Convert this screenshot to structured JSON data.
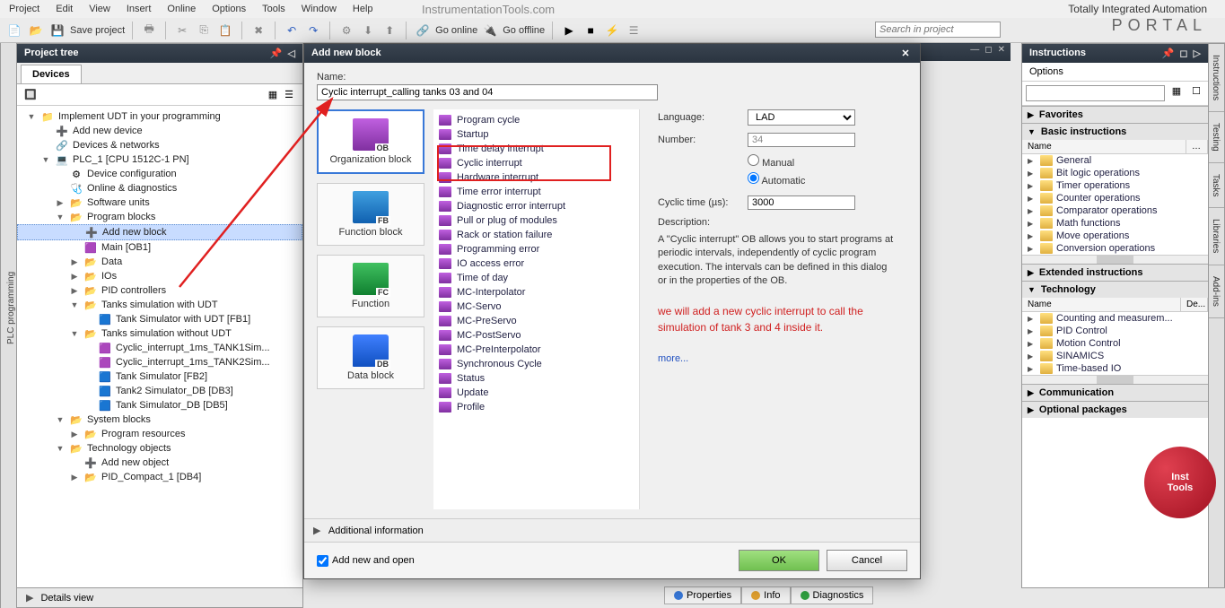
{
  "menus": [
    "Project",
    "Edit",
    "View",
    "Insert",
    "Online",
    "Options",
    "Tools",
    "Window",
    "Help"
  ],
  "watermark": "InstrumentationTools.com",
  "portal_top": "Totally Integrated Automation",
  "portal_big": "PORTAL",
  "toolbar": {
    "save": "Save project",
    "go_online": "Go online",
    "go_offline": "Go offline",
    "search_placeholder": "Search in project"
  },
  "left_tab": "PLC programming",
  "project_tree": {
    "title": "Project tree",
    "tab": "Devices",
    "nodes": [
      {
        "indent": 0,
        "toggle": "▼",
        "icon": "📁",
        "label": "Implement UDT in your programming"
      },
      {
        "indent": 1,
        "toggle": "",
        "icon": "➕",
        "label": "Add new device"
      },
      {
        "indent": 1,
        "toggle": "",
        "icon": "🔗",
        "label": "Devices & networks"
      },
      {
        "indent": 1,
        "toggle": "▼",
        "icon": "💻",
        "label": "PLC_1 [CPU 1512C-1 PN]"
      },
      {
        "indent": 2,
        "toggle": "",
        "icon": "⚙",
        "label": "Device configuration"
      },
      {
        "indent": 2,
        "toggle": "",
        "icon": "🩺",
        "label": "Online & diagnostics"
      },
      {
        "indent": 2,
        "toggle": "▶",
        "icon": "📂",
        "label": "Software units"
      },
      {
        "indent": 2,
        "toggle": "▼",
        "icon": "📂",
        "label": "Program blocks"
      },
      {
        "indent": 3,
        "toggle": "",
        "icon": "➕",
        "label": "Add new block",
        "selected": true
      },
      {
        "indent": 3,
        "toggle": "",
        "icon": "🟪",
        "label": "Main [OB1]"
      },
      {
        "indent": 3,
        "toggle": "▶",
        "icon": "📂",
        "label": "Data"
      },
      {
        "indent": 3,
        "toggle": "▶",
        "icon": "📂",
        "label": "IOs"
      },
      {
        "indent": 3,
        "toggle": "▶",
        "icon": "📂",
        "label": "PID controllers"
      },
      {
        "indent": 3,
        "toggle": "▼",
        "icon": "📂",
        "label": "Tanks simulation with UDT"
      },
      {
        "indent": 4,
        "toggle": "",
        "icon": "🟦",
        "label": "Tank Simulator with UDT [FB1]"
      },
      {
        "indent": 3,
        "toggle": "▼",
        "icon": "📂",
        "label": "Tanks simulation without UDT"
      },
      {
        "indent": 4,
        "toggle": "",
        "icon": "🟪",
        "label": "Cyclic_interrupt_1ms_TANK1Sim..."
      },
      {
        "indent": 4,
        "toggle": "",
        "icon": "🟪",
        "label": "Cyclic_interrupt_1ms_TANK2Sim..."
      },
      {
        "indent": 4,
        "toggle": "",
        "icon": "🟦",
        "label": "Tank Simulator [FB2]"
      },
      {
        "indent": 4,
        "toggle": "",
        "icon": "🟦",
        "label": "Tank2 Simulator_DB [DB3]"
      },
      {
        "indent": 4,
        "toggle": "",
        "icon": "🟦",
        "label": "Tank Simulator_DB [DB5]"
      },
      {
        "indent": 2,
        "toggle": "▼",
        "icon": "📂",
        "label": "System blocks"
      },
      {
        "indent": 3,
        "toggle": "▶",
        "icon": "📂",
        "label": "Program resources"
      },
      {
        "indent": 2,
        "toggle": "▼",
        "icon": "📂",
        "label": "Technology objects"
      },
      {
        "indent": 3,
        "toggle": "",
        "icon": "➕",
        "label": "Add new object"
      },
      {
        "indent": 3,
        "toggle": "▶",
        "icon": "📂",
        "label": "PID_Compact_1 [DB4]"
      }
    ]
  },
  "details": "Details view",
  "dialog": {
    "title": "Add new block",
    "name_label": "Name:",
    "name_value": "Cyclic interrupt_calling tanks 03 and 04",
    "block_types": [
      {
        "code": "OB",
        "label": "Organization block",
        "cls": "bt-ob",
        "selected": true
      },
      {
        "code": "FB",
        "label": "Function block",
        "cls": "bt-fb"
      },
      {
        "code": "FC",
        "label": "Function",
        "cls": "bt-fc"
      },
      {
        "code": "DB",
        "label": "Data block",
        "cls": "bt-db"
      }
    ],
    "ob_types": [
      "Program cycle",
      "Startup",
      "Time delay interrupt",
      "Cyclic interrupt",
      "Hardware interrupt",
      "Time error interrupt",
      "Diagnostic error interrupt",
      "Pull or plug of modules",
      "Rack or station failure",
      "Programming error",
      "IO access error",
      "Time of day",
      "MC-Interpolator",
      "MC-Servo",
      "MC-PreServo",
      "MC-PostServo",
      "MC-PreInterpolator",
      "Synchronous Cycle",
      "Status",
      "Update",
      "Profile"
    ],
    "props": {
      "language_label": "Language:",
      "language_value": "LAD",
      "number_label": "Number:",
      "number_value": "34",
      "manual": "Manual",
      "automatic": "Automatic",
      "cyclic_label": "Cyclic time (µs):",
      "cyclic_value": "3000",
      "desc_label": "Description:",
      "desc_text": "A \"Cyclic interrupt\" OB allows you to start programs at periodic intervals, independently of cyclic program execution. The intervals can be defined in this dialog or in the properties of the OB.",
      "annotation": "we will add a new cyclic interrupt to call the simulation of tank 3 and 4 inside it.",
      "more": "more..."
    },
    "additional": "Additional information",
    "add_open": "Add new and open",
    "ok": "OK",
    "cancel": "Cancel"
  },
  "right": {
    "title": "Instructions",
    "options": "Options",
    "sections": {
      "favorites": "Favorites",
      "basic": "Basic instructions",
      "extended": "Extended instructions",
      "technology": "Technology",
      "communication": "Communication",
      "optional": "Optional packages"
    },
    "col_name": "Name",
    "col_desc": "De...",
    "basic_items": [
      "General",
      "Bit logic operations",
      "Timer operations",
      "Counter operations",
      "Comparator operations",
      "Math functions",
      "Move operations",
      "Conversion operations"
    ],
    "tech_items": [
      "Counting and measurem...",
      "PID Control",
      "Motion Control",
      "SINAMICS",
      "Time-based IO"
    ],
    "tabs": [
      "Instructions",
      "Testing",
      "Tasks",
      "Libraries",
      "Add-ins"
    ]
  },
  "bottom": {
    "properties": "Properties",
    "info": "Info",
    "diagnostics": "Diagnostics"
  },
  "badge": {
    "line1": "Inst",
    "line2": "Tools"
  }
}
